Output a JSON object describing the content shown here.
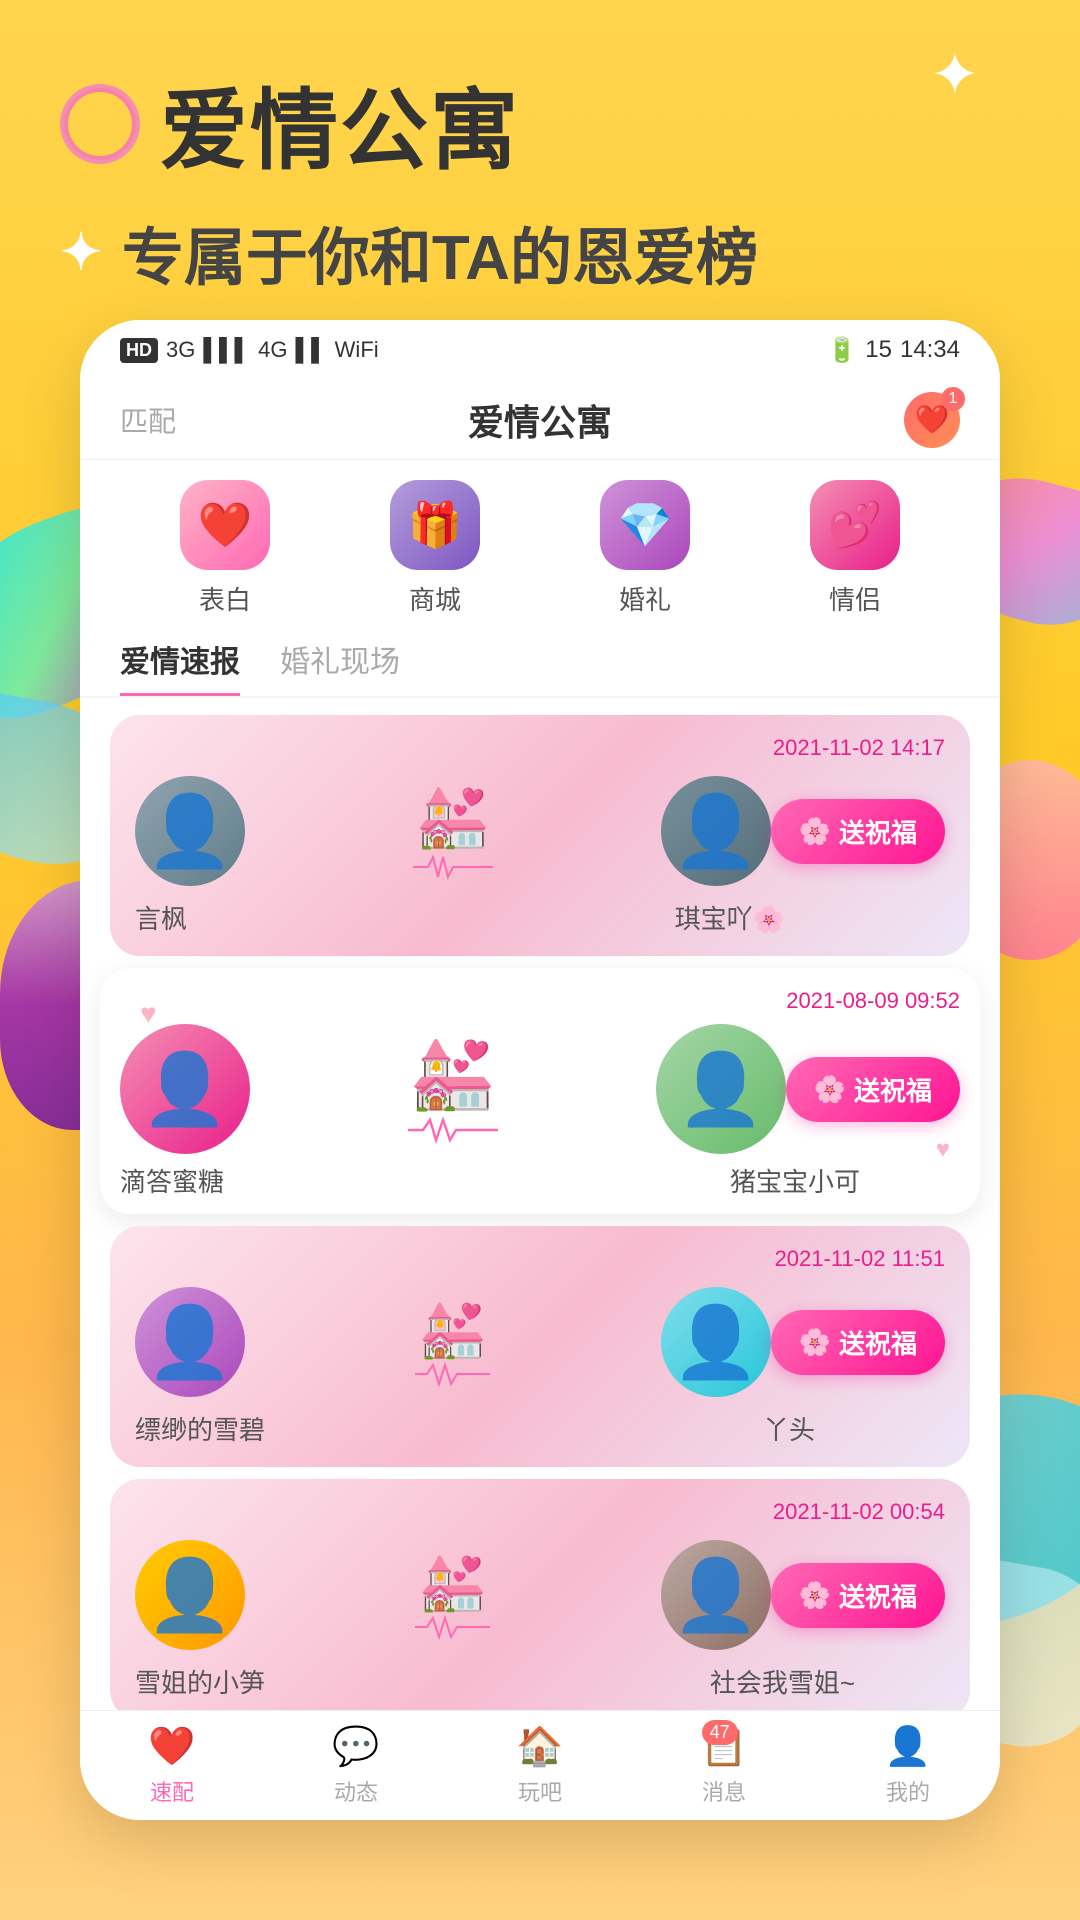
{
  "app": {
    "title": "爱情公寓",
    "subtitle": "专属于你和TA的恩爱榜",
    "subtitle_sparkle": "✦",
    "nav_match": "匹配",
    "time": "14:34",
    "battery": "15",
    "signal": "4G",
    "features": [
      {
        "label": "表白",
        "icon": "❤️",
        "color": "pink"
      },
      {
        "label": "商城",
        "icon": "🎁",
        "color": "purple"
      },
      {
        "label": "婚礼",
        "icon": "💎",
        "color": "lavender"
      },
      {
        "label": "情侣",
        "icon": "💕",
        "color": "rose"
      }
    ],
    "tabs": [
      {
        "label": "爱情速报",
        "active": true
      },
      {
        "label": "婚礼现场",
        "active": false
      }
    ],
    "couples": [
      {
        "timestamp": "2021-11-02 14:17",
        "name1": "言枫",
        "name2": "琪宝吖🌸",
        "btn_label": "送祝福"
      },
      {
        "timestamp": "2021-08-09 09:52",
        "name1": "滴答蜜糖",
        "name2": "猪宝宝小可",
        "btn_label": "送祝福"
      },
      {
        "timestamp": "2021-11-02 11:51",
        "name1": "缥缈的雪碧",
        "name2": "丫头",
        "btn_label": "送祝福"
      },
      {
        "timestamp": "2021-11-02 00:54",
        "name1": "雪姐的小笋",
        "name2": "社会我雪姐~",
        "btn_label": "送祝福"
      }
    ],
    "bottom_nav": [
      {
        "label": "速配",
        "icon": "❤️",
        "active": true
      },
      {
        "label": "动态",
        "icon": "💬",
        "active": false
      },
      {
        "label": "玩吧",
        "icon": "🏠",
        "active": false
      },
      {
        "label": "消息",
        "icon": "📋",
        "active": false,
        "badge": "47"
      },
      {
        "label": "我的",
        "icon": "👤",
        "active": false
      }
    ]
  }
}
